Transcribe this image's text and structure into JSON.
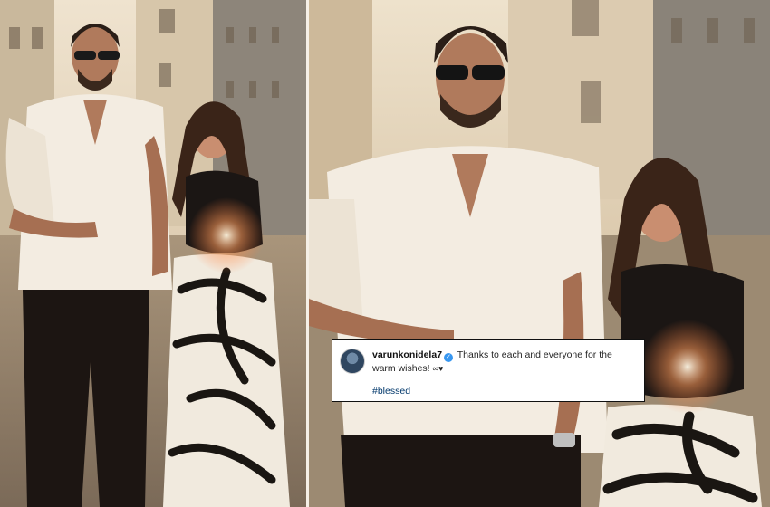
{
  "caption": {
    "username": "varunkonidela7",
    "text": "Thanks to each and everyone for the warm wishes!",
    "emojis": "∞♥",
    "hashtag": "#blessed"
  },
  "icons": [
    "avatar",
    "verified-badge-icon"
  ],
  "colors": {
    "link": "#00376b",
    "verified": "#3897f0",
    "card_bg": "#ffffff"
  }
}
